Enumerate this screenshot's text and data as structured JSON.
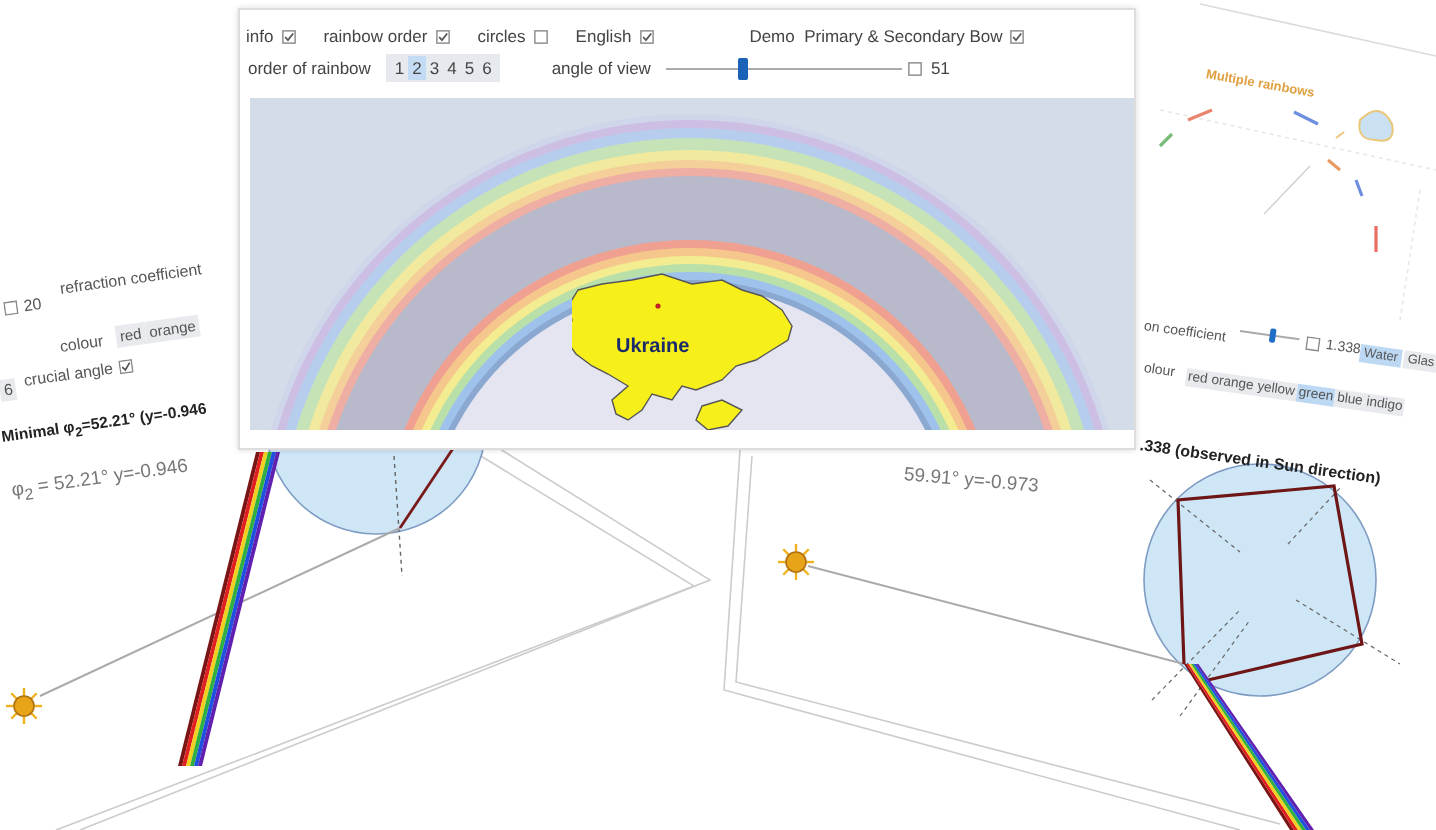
{
  "left_panel": {
    "slider": {
      "checked": false,
      "value": "20"
    },
    "refraction_label": "refraction coefficient",
    "orders": [
      {
        "label": "6",
        "selected": false
      }
    ],
    "crucial_angle": {
      "label": "crucial angle",
      "checked": true
    },
    "colour_label": "colour",
    "colours": [
      {
        "label": "red",
        "selected": false
      },
      {
        "label": "orange",
        "selected": false
      }
    ],
    "title": "Minimal φ$_{2}$=52.21° (y=-0.946",
    "reading": "φ$_{2}$ = 52.21°  y=-0.946"
  },
  "right_panel": {
    "refraction_label": "on coefficient",
    "colour_label": "olour",
    "slider": {
      "level": 0.5,
      "checked": false,
      "value": "1.338"
    },
    "media": [
      {
        "label": "Water",
        "selected": true
      },
      {
        "label": "Glas",
        "selected": false
      }
    ],
    "colours": [
      {
        "label": "red",
        "selected": false
      },
      {
        "label": "orange",
        "selected": false
      },
      {
        "label": "yellow",
        "selected": false
      },
      {
        "label": "green",
        "selected": true
      },
      {
        "label": "blue",
        "selected": false
      },
      {
        "label": "indigo",
        "selected": false
      }
    ],
    "title": ".338 (observed in Sun direction)",
    "reading": "59.91°  y=-0.973"
  },
  "back_panel": {
    "title": "Multiple rainbows"
  },
  "main_window": {
    "options": [
      {
        "label": "info",
        "checked": true
      },
      {
        "label": "rainbow order",
        "checked": true
      },
      {
        "label": "circles",
        "checked": false
      },
      {
        "label": "English",
        "checked": true
      }
    ],
    "demo": {
      "label": "Demo  Primary & Secondary Bow",
      "checked": true
    },
    "order_label": "order of rainbow",
    "orders": [
      {
        "label": "1",
        "selected": false
      },
      {
        "label": "2",
        "selected": true
      },
      {
        "label": "3",
        "selected": false
      },
      {
        "label": "4",
        "selected": false
      },
      {
        "label": "5",
        "selected": false
      },
      {
        "label": "6",
        "selected": false
      }
    ],
    "angle": {
      "label": "angle of view",
      "level": 0.3,
      "checked": false,
      "value": "51"
    },
    "map_label": "Ukraine"
  }
}
